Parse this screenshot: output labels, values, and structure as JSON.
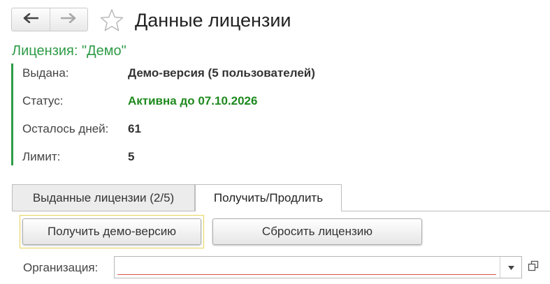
{
  "window": {
    "title": "Данные лицензии",
    "icons": {
      "back": "arrow-left-icon",
      "forward": "arrow-right-icon",
      "favorite": "star-icon"
    }
  },
  "license": {
    "heading": "Лицензия: \"Демо\"",
    "accent_color": "#2f9b47",
    "fields": [
      {
        "label": "Выдана:",
        "value": "Демо-версия (5 пользователей)"
      },
      {
        "label": "Статус:",
        "value": "Активна до 07.10.2026",
        "value_color": "#1e8a1e"
      },
      {
        "label": "Осталось дней:",
        "value": "61"
      },
      {
        "label": "Лимит:",
        "value": "5"
      }
    ]
  },
  "tabs": [
    {
      "label": "Выданные лицензии (2/5)",
      "active": false
    },
    {
      "label": "Получить/Продлить",
      "active": true
    }
  ],
  "actions": {
    "get_demo": "Получить демо-версию",
    "reset": "Сбросить лицензию"
  },
  "organization": {
    "label": "Организация:",
    "value": "",
    "icons": {
      "dropdown": "chevron-down-icon",
      "open": "open-window-icon"
    }
  }
}
